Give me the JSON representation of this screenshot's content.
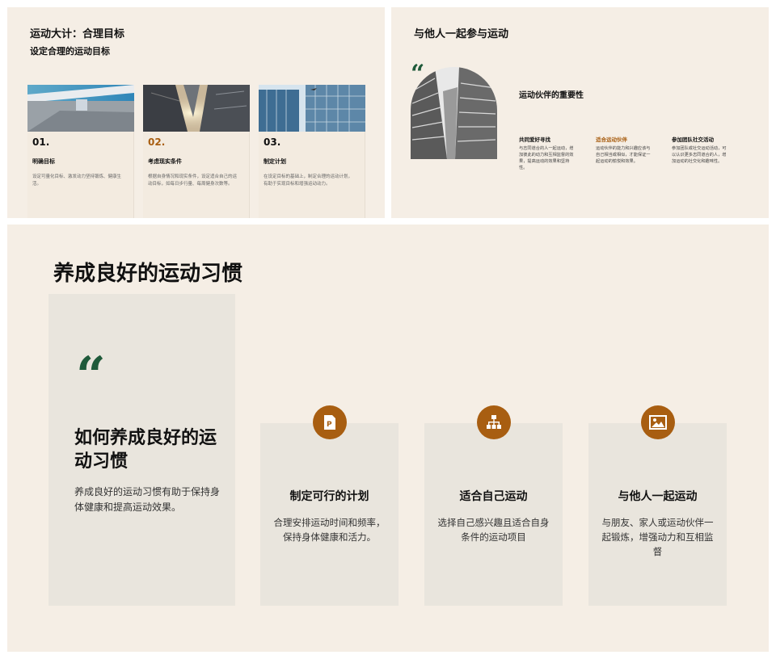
{
  "slide1": {
    "title": "运动大计：合理目标",
    "subtitle": "设定合理的运动目标",
    "steps": [
      {
        "num": "01.",
        "title": "明确目标",
        "desc": "设定可量化目标、激发动力坚持锻炼、健康生活。"
      },
      {
        "num": "02.",
        "title": "考虑现实条件",
        "desc": "根据自身情况和现实条件，设定适合自己的运动目标，如每日步行量、每周健身次数等。"
      },
      {
        "num": "03.",
        "title": "制定计划",
        "desc": "在设定目标的基础上，制定合理的运动计划，有助于实现目标和增强运动动力。"
      }
    ]
  },
  "slide2": {
    "title": "与他人一起参与运动",
    "quote_mark": "“",
    "heading": "运动伙伴的重要性",
    "columns": [
      {
        "title": "共同爱好寻找",
        "desc": "与志同道合的人一起运动，增加彼此的动力和互相监督的效果，提高运动的效果和坚持性。"
      },
      {
        "title": "适合运动伙伴",
        "desc": "运动伙伴的能力和兴趣应该与自己相当或相似，才能保证一起运动的愉悦和效果。"
      },
      {
        "title": "参加团队社交活动",
        "desc": "参加团队或社交运动活动，可以认识更多志同道合的人，增加运动的社交化和趣味性。"
      }
    ]
  },
  "slide3": {
    "title": "养成良好的运动习惯",
    "quote_mark": "“",
    "left_heading": "如何养成良好的运动习惯",
    "left_desc": "养成良好的运动习惯有助于保持身体健康和提高运动效果。",
    "cards": [
      {
        "icon": "document-p-icon",
        "title": "制定可行的计划",
        "desc": "合理安排运动时间和频率，保持身体健康和活力。"
      },
      {
        "icon": "org-chart-icon",
        "title": "适合自己运动",
        "desc": "选择自己感兴趣且适合自身条件的运动项目"
      },
      {
        "icon": "image-icon",
        "title": "与他人一起运动",
        "desc": "与朋友、家人或运动伙伴一起锻炼，增强动力和互相监督"
      }
    ]
  },
  "colors": {
    "background": "#f5eee5",
    "accent": "#a85e11",
    "quote_green": "#1f5a3a",
    "card": "#e9e5dd"
  }
}
